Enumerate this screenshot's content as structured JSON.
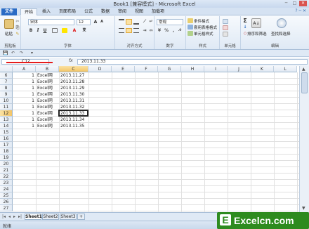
{
  "window": {
    "title": "Book1 [兼容模式] - Microsoft Excel",
    "minimize": "─",
    "restore": "□",
    "close": "✕"
  },
  "tabs": [
    {
      "label": "文件"
    },
    {
      "label": "开始"
    },
    {
      "label": "插入"
    },
    {
      "label": "页面布局"
    },
    {
      "label": "公式"
    },
    {
      "label": "数据"
    },
    {
      "label": "审阅"
    },
    {
      "label": "视图"
    },
    {
      "label": "加载项"
    }
  ],
  "ribbon": {
    "clipboard": {
      "paste": "粘贴",
      "label": "剪贴板"
    },
    "font": {
      "name": "宋体",
      "size": "12",
      "bold": "B",
      "italic": "I",
      "underline": "U",
      "grow": "A",
      "shrink": "A",
      "wen": "变",
      "label": "字体"
    },
    "alignment": {
      "label": "对齐方式"
    },
    "number": {
      "format": "常规",
      "label": "数字"
    },
    "styles": {
      "cond": "条件格式",
      "table": "套用表格格式",
      "cell": "单元格样式",
      "label": "样式"
    },
    "cells": {
      "label": "单元格"
    },
    "editing": {
      "sigma": "Σ",
      "sort": "排序和筛选",
      "find": "查找和选择",
      "label": "编辑"
    }
  },
  "qat": {
    "save": "💾",
    "undo": "↶",
    "redo": "↷",
    "more": "▾"
  },
  "formula_bar": {
    "name_box": "C12",
    "fx": "fx",
    "value": "2013.11.33"
  },
  "grid": {
    "columns": [
      "A",
      "B",
      "C",
      "D",
      "E",
      "F",
      "G",
      "H",
      "I",
      "J",
      "K",
      "L"
    ],
    "selected_column": "C",
    "selected_row": "12",
    "rows": [
      {
        "num": "6",
        "a": "1",
        "b": "Excel网",
        "c": "2013.11.27"
      },
      {
        "num": "7",
        "a": "1",
        "b": "Excel网",
        "c": "2013.11.28"
      },
      {
        "num": "8",
        "a": "1",
        "b": "Excel网",
        "c": "2013.11.29"
      },
      {
        "num": "9",
        "a": "1",
        "b": "Excel网",
        "c": "2013.11.30"
      },
      {
        "num": "10",
        "a": "1",
        "b": "Excel网",
        "c": "2013.11.31"
      },
      {
        "num": "11",
        "a": "1",
        "b": "Excel网",
        "c": "2013.11.32"
      },
      {
        "num": "12",
        "a": "1",
        "b": "Excel网",
        "c": "2013.11.33"
      },
      {
        "num": "13",
        "a": "1",
        "b": "Excel网",
        "c": "2013.11.34"
      },
      {
        "num": "14",
        "a": "1",
        "b": "Excel网",
        "c": "2013.11.35"
      },
      {
        "num": "15",
        "a": "",
        "b": "",
        "c": ""
      },
      {
        "num": "16",
        "a": "",
        "b": "",
        "c": ""
      },
      {
        "num": "17",
        "a": "",
        "b": "",
        "c": ""
      },
      {
        "num": "18",
        "a": "",
        "b": "",
        "c": ""
      },
      {
        "num": "19",
        "a": "",
        "b": "",
        "c": ""
      },
      {
        "num": "20",
        "a": "",
        "b": "",
        "c": ""
      },
      {
        "num": "21",
        "a": "",
        "b": "",
        "c": ""
      },
      {
        "num": "22",
        "a": "",
        "b": "",
        "c": ""
      },
      {
        "num": "23",
        "a": "",
        "b": "",
        "c": ""
      },
      {
        "num": "24",
        "a": "",
        "b": "",
        "c": ""
      },
      {
        "num": "25",
        "a": "",
        "b": "",
        "c": ""
      },
      {
        "num": "26",
        "a": "",
        "b": "",
        "c": ""
      },
      {
        "num": "27",
        "a": "",
        "b": "",
        "c": ""
      }
    ]
  },
  "sheets": [
    {
      "label": "Sheet1",
      "active": true
    },
    {
      "label": "Sheet2",
      "active": false
    },
    {
      "label": "Sheet3",
      "active": false
    }
  ],
  "sheet_nav": [
    "|◂",
    "◂",
    "▸",
    "▸|"
  ],
  "status": {
    "ready": "就绪"
  },
  "logo": {
    "text": "Excelcn.com",
    "mark": "E"
  },
  "colors": {
    "accent": "#2a6bc4",
    "selected_header": "#f3c466",
    "logo_green": "#2e8b1f",
    "annotation_red": "#e51c1c"
  }
}
